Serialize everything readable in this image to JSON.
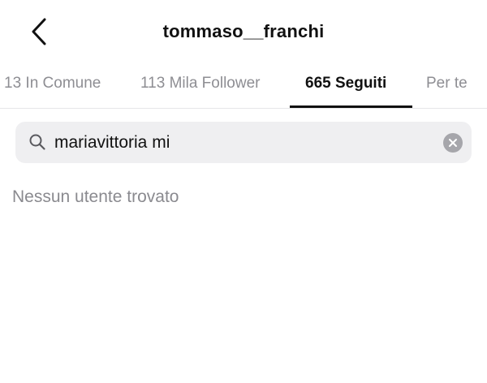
{
  "header": {
    "back_icon": "chevron-left-icon",
    "username": "tommaso__franchi"
  },
  "tabs": [
    {
      "label": "13 In Comune",
      "active": false
    },
    {
      "label": "113 Mila Follower",
      "active": false
    },
    {
      "label": "665 Seguiti",
      "active": true
    },
    {
      "label": "Per te",
      "active": false
    }
  ],
  "search": {
    "icon": "search-icon",
    "value": "mariavittoria mi",
    "clear_icon": "clear-icon"
  },
  "results": {
    "empty_message": "Nessun utente trovato"
  }
}
